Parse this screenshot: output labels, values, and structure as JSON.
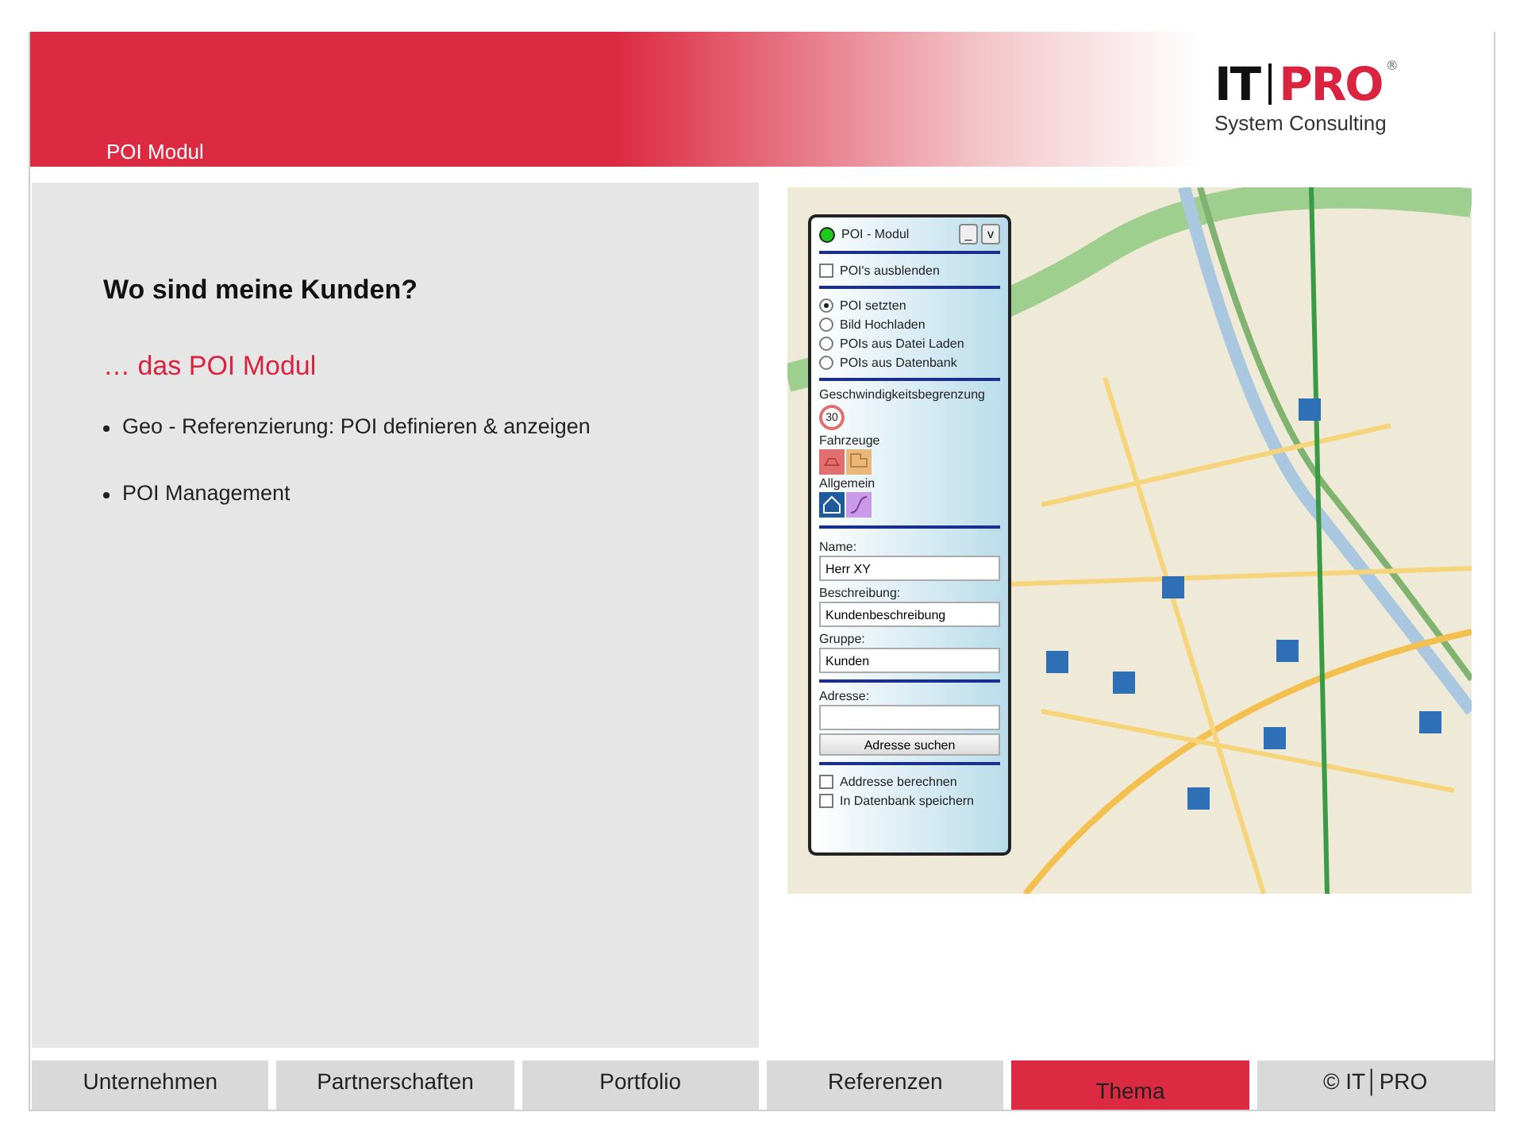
{
  "header": {
    "title": "POI Modul",
    "logo": {
      "left": "IT",
      "right": "PRO",
      "mark": "®",
      "tagline": "System Consulting"
    }
  },
  "content": {
    "heading": "Wo sind meine Kunden?",
    "subheading": "… das POI Modul",
    "bullets": [
      "Geo - Referenzierung: POI definieren & anzeigen",
      "POI Management"
    ]
  },
  "poi_panel": {
    "title": "POI - Modul",
    "window_buttons": [
      "_",
      "v"
    ],
    "hide_option": {
      "label": "POI's ausblenden",
      "checked": false
    },
    "modes": [
      {
        "label": "POI setzten",
        "selected": true
      },
      {
        "label": "Bild Hochladen",
        "selected": false
      },
      {
        "label": "POIs aus Datei Laden",
        "selected": false
      },
      {
        "label": "POIs aus Datenbank",
        "selected": false
      }
    ],
    "speed_label": "Geschwindigkeitsbegrenzung",
    "speed_sign": "30",
    "vehicles_label": "Fahrzeuge",
    "general_label": "Allgemein",
    "fields": [
      {
        "label": "Name:",
        "value": "Herr XY"
      },
      {
        "label": "Beschreibung:",
        "value": "Kundenbeschreibung"
      },
      {
        "label": "Gruppe:",
        "value": "Kunden"
      }
    ],
    "address_label": "Adresse:",
    "search_button": "Adresse suchen",
    "options": [
      {
        "label": "Addresse berechnen",
        "checked": false
      },
      {
        "label": "In Datenbank speichern",
        "checked": false
      }
    ]
  },
  "nav": [
    {
      "label": "Unternehmen",
      "selected": false
    },
    {
      "label": "Partnerschaften",
      "selected": false
    },
    {
      "label": "Portfolio",
      "selected": false
    },
    {
      "label": "Referenzen",
      "selected": false
    },
    {
      "label": "Thema",
      "selected": true
    },
    {
      "label": "© IT│PRO",
      "selected": false
    }
  ]
}
